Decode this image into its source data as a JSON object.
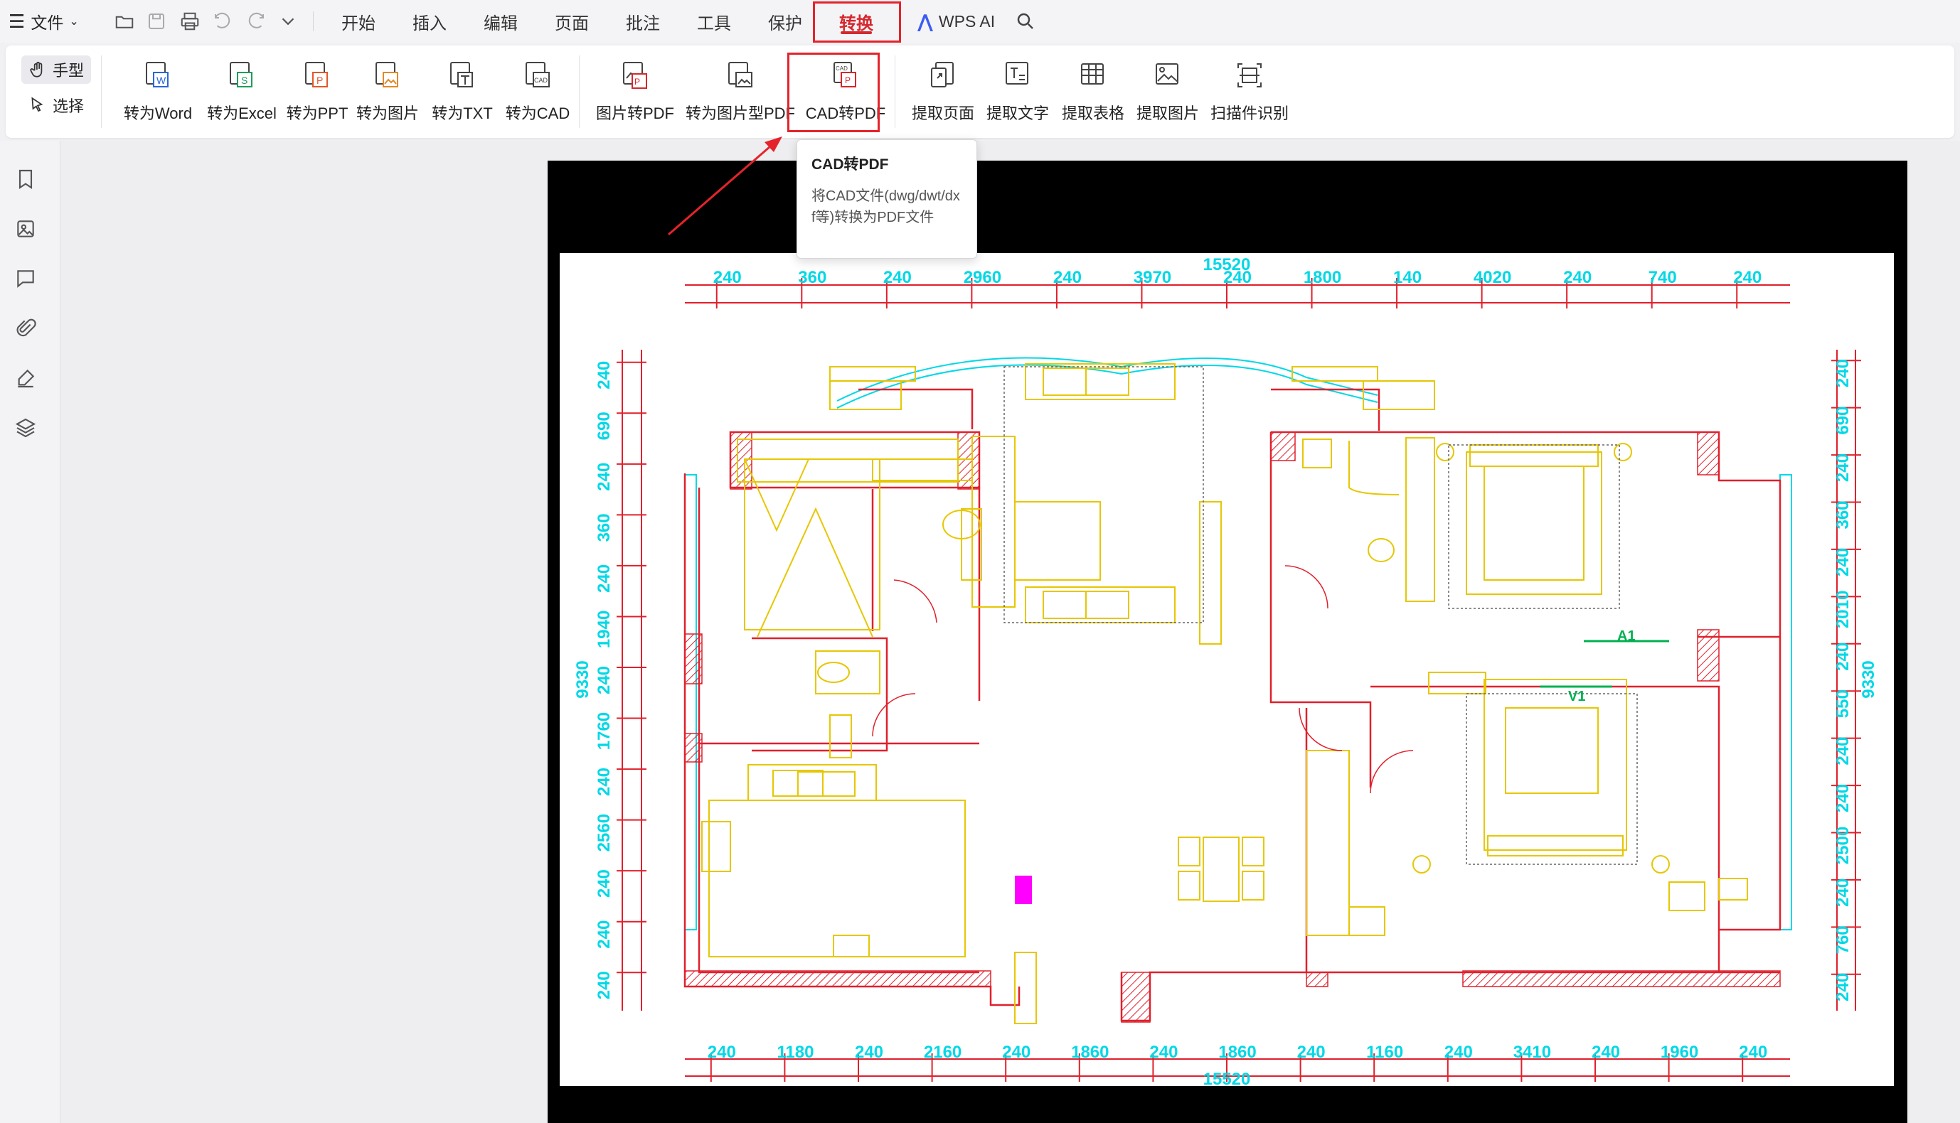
{
  "menubar": {
    "file_label": "文件",
    "tabs": [
      {
        "label": "开始"
      },
      {
        "label": "插入"
      },
      {
        "label": "编辑"
      },
      {
        "label": "页面"
      },
      {
        "label": "批注"
      },
      {
        "label": "工具"
      },
      {
        "label": "保护"
      },
      {
        "label": "转换",
        "active": true
      }
    ],
    "ai_label": "WPS AI"
  },
  "ribbon": {
    "hand_label": "手型",
    "select_label": "选择",
    "buttons": [
      {
        "label": "转为Word",
        "icon": "to-word-icon"
      },
      {
        "label": "转为Excel",
        "icon": "to-excel-icon"
      },
      {
        "label": "转为PPT",
        "icon": "to-ppt-icon"
      },
      {
        "label": "转为图片",
        "icon": "to-image-icon"
      },
      {
        "label": "转为TXT",
        "icon": "to-txt-icon"
      },
      {
        "label": "转为CAD",
        "icon": "to-cad-icon"
      },
      {
        "label": "图片转PDF",
        "icon": "image-to-pdf-icon"
      },
      {
        "label": "转为图片型PDF",
        "icon": "to-image-pdf-icon"
      },
      {
        "label": "CAD转PDF",
        "icon": "cad-to-pdf-icon",
        "highlighted": true
      },
      {
        "label": "提取页面",
        "icon": "extract-page-icon"
      },
      {
        "label": "提取文字",
        "icon": "extract-text-icon"
      },
      {
        "label": "提取表格",
        "icon": "extract-table-icon"
      },
      {
        "label": "提取图片",
        "icon": "extract-image-icon"
      },
      {
        "label": "扫描件识别",
        "icon": "scan-ocr-icon"
      }
    ]
  },
  "tooltip": {
    "title": "CAD转PDF",
    "description": "将CAD文件(dwg/dwt/dxf等)转换为PDF文件"
  },
  "sidebar": {
    "icons": [
      "bookmark-icon",
      "thumbnail-icon",
      "comment-icon",
      "attachment-icon",
      "signature-icon",
      "layers-icon"
    ]
  },
  "drawing": {
    "top_total": "15520",
    "top_dims": [
      "240",
      "360",
      "240",
      "2960",
      "240",
      "3970",
      "240",
      "1800",
      "140",
      "4020",
      "240",
      "740",
      "240"
    ],
    "bottom_dims": [
      "240",
      "1180",
      "240",
      "2160",
      "240",
      "1860",
      "240",
      "1860",
      "240",
      "1160",
      "240",
      "3410",
      "240",
      "1960",
      "240"
    ],
    "bottom_total": "15520",
    "left_dims": [
      "240",
      "690",
      "240",
      "360",
      "240",
      "1940",
      "240",
      "1760",
      "240",
      "2560",
      "240",
      "240",
      "240"
    ],
    "left_total": "9330",
    "right_dims": [
      "240",
      "690",
      "240",
      "360",
      "240",
      "2010",
      "240",
      "550",
      "240",
      "240",
      "2500",
      "240",
      "760",
      "240"
    ],
    "right_total": "9330",
    "markers": [
      "A1",
      "V1"
    ]
  },
  "colors": {
    "accent": "#d4282e",
    "highlight_box": "#e5232b",
    "cad_red": "#e0202c",
    "cad_cyan": "#00d8e6",
    "cad_yellow": "#e6c700"
  }
}
